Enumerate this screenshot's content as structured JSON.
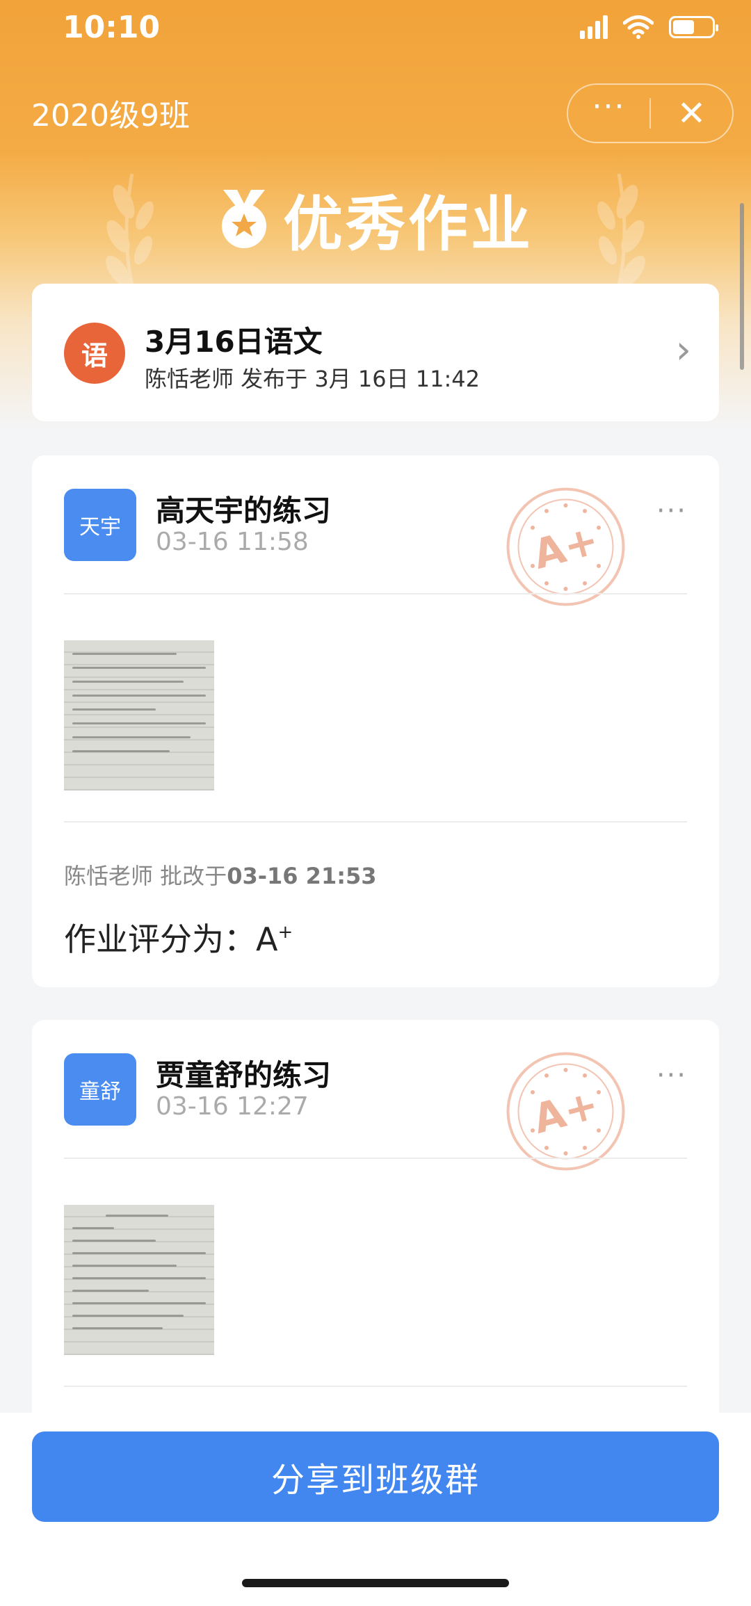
{
  "status": {
    "time": "10:10"
  },
  "nav": {
    "title": "2020级9班",
    "more_label": "···",
    "close_label": "✕"
  },
  "hero": {
    "title": "优秀作业"
  },
  "summary": {
    "subject_icon": "语",
    "title": "3月16日语文",
    "subtitle": "陈恬老师 发布于 3月 16日 11:42",
    "chevron": "›"
  },
  "homeworks": [
    {
      "avatar": "天宇",
      "title": "高天宇的练习",
      "time": "03-16 11:58",
      "more": "···",
      "stamp": "A+",
      "review_prefix": "陈恬老师 批改于",
      "review_time": "03-16 21:53",
      "score_label": "作业评分为：",
      "score_value": "A",
      "score_sup": "+"
    },
    {
      "avatar": "童舒",
      "title": "贾童舒的练习",
      "time": "03-16 12:27",
      "more": "···",
      "stamp": "A+"
    }
  ],
  "footer": {
    "share_label": "分享到班级群"
  },
  "colors": {
    "brand_orange": "#f2a33a",
    "primary_blue": "#4286f0",
    "subject_red": "#e8653a"
  },
  "icons": [
    "signal-icon",
    "wifi-icon",
    "battery-icon",
    "medal-icon",
    "wheat-icon",
    "chevron-right-icon",
    "more-icon",
    "stamp-icon",
    "close-icon"
  ]
}
